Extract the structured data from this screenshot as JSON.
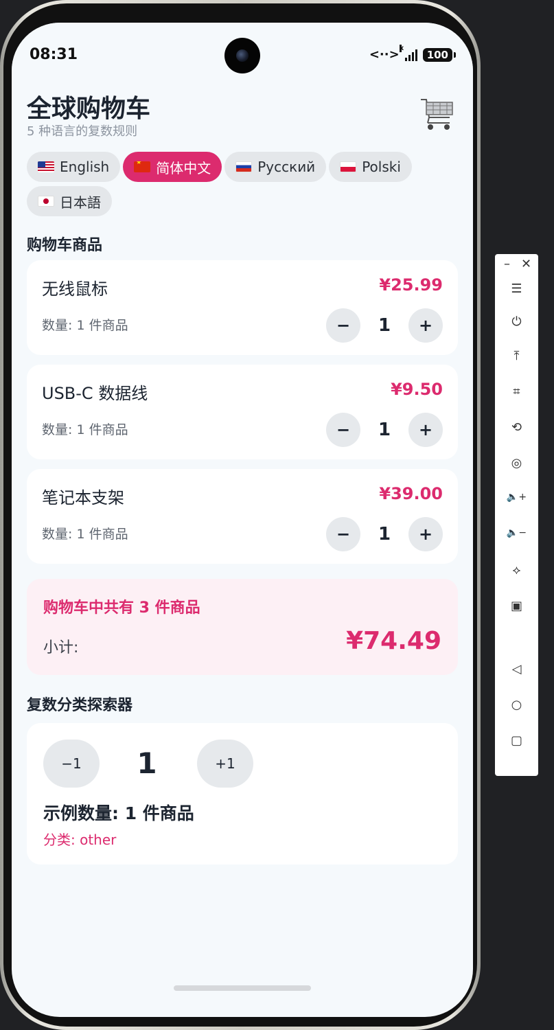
{
  "status": {
    "time": "08:31",
    "network": "<··>",
    "signal_mark": "x",
    "battery": "100"
  },
  "header": {
    "title": "全球购物车",
    "subtitle": "5 种语言的复数规则",
    "cart_icon": "shopping-cart-icon"
  },
  "languages": [
    {
      "label": "English",
      "flag": "us",
      "active": false
    },
    {
      "label": "简体中文",
      "flag": "cn",
      "active": true
    },
    {
      "label": "Русский",
      "flag": "ru",
      "active": false
    },
    {
      "label": "Polski",
      "flag": "pl",
      "active": false
    },
    {
      "label": "日本語",
      "flag": "jp",
      "active": false
    }
  ],
  "cart": {
    "section_title": "购物车商品",
    "items": [
      {
        "name": "无线鼠标",
        "price": "¥25.99",
        "qty_label": "数量: 1 件商品",
        "qty": "1"
      },
      {
        "name": "USB-C 数据线",
        "price": "¥9.50",
        "qty_label": "数量: 1 件商品",
        "qty": "1"
      },
      {
        "name": "笔记本支架",
        "price": "¥39.00",
        "qty_label": "数量: 1 件商品",
        "qty": "1"
      }
    ],
    "stepper": {
      "minus": "−",
      "plus": "+"
    }
  },
  "summary": {
    "count_text": "购物车中共有 3 件商品",
    "subtotal_label": "小计:",
    "subtotal_value": "¥74.49"
  },
  "explorer": {
    "section_title": "复数分类探索器",
    "minus_label": "−1",
    "plus_label": "+1",
    "count": "1",
    "example_text": "示例数量: 1 件商品",
    "category_text": "分类: other"
  },
  "toolbar": {
    "items": [
      {
        "name": "minimize-icon",
        "glyph": "–"
      },
      {
        "name": "close-icon",
        "glyph": "✕"
      },
      {
        "name": "menu-icon",
        "glyph": "☰"
      },
      {
        "name": "power-icon",
        "glyph": "⏻"
      },
      {
        "name": "upload-icon",
        "glyph": "⤒"
      },
      {
        "name": "crop-icon",
        "glyph": "⌗"
      },
      {
        "name": "rotate-icon",
        "glyph": "⟲"
      },
      {
        "name": "screenshot-icon",
        "glyph": "◎"
      },
      {
        "name": "volume-up-icon",
        "glyph": "🔈+"
      },
      {
        "name": "volume-down-icon",
        "glyph": "🔈−"
      },
      {
        "name": "vibrate-icon",
        "glyph": "⟡"
      },
      {
        "name": "devices-icon",
        "glyph": "▣"
      },
      {
        "name": "back-icon",
        "glyph": "◁"
      },
      {
        "name": "home-icon",
        "glyph": "○"
      },
      {
        "name": "overview-icon",
        "glyph": "▢"
      }
    ]
  },
  "colors": {
    "accent": "#dc2b6e",
    "background": "#f5f9fc",
    "chip": "#e4e7ea"
  }
}
